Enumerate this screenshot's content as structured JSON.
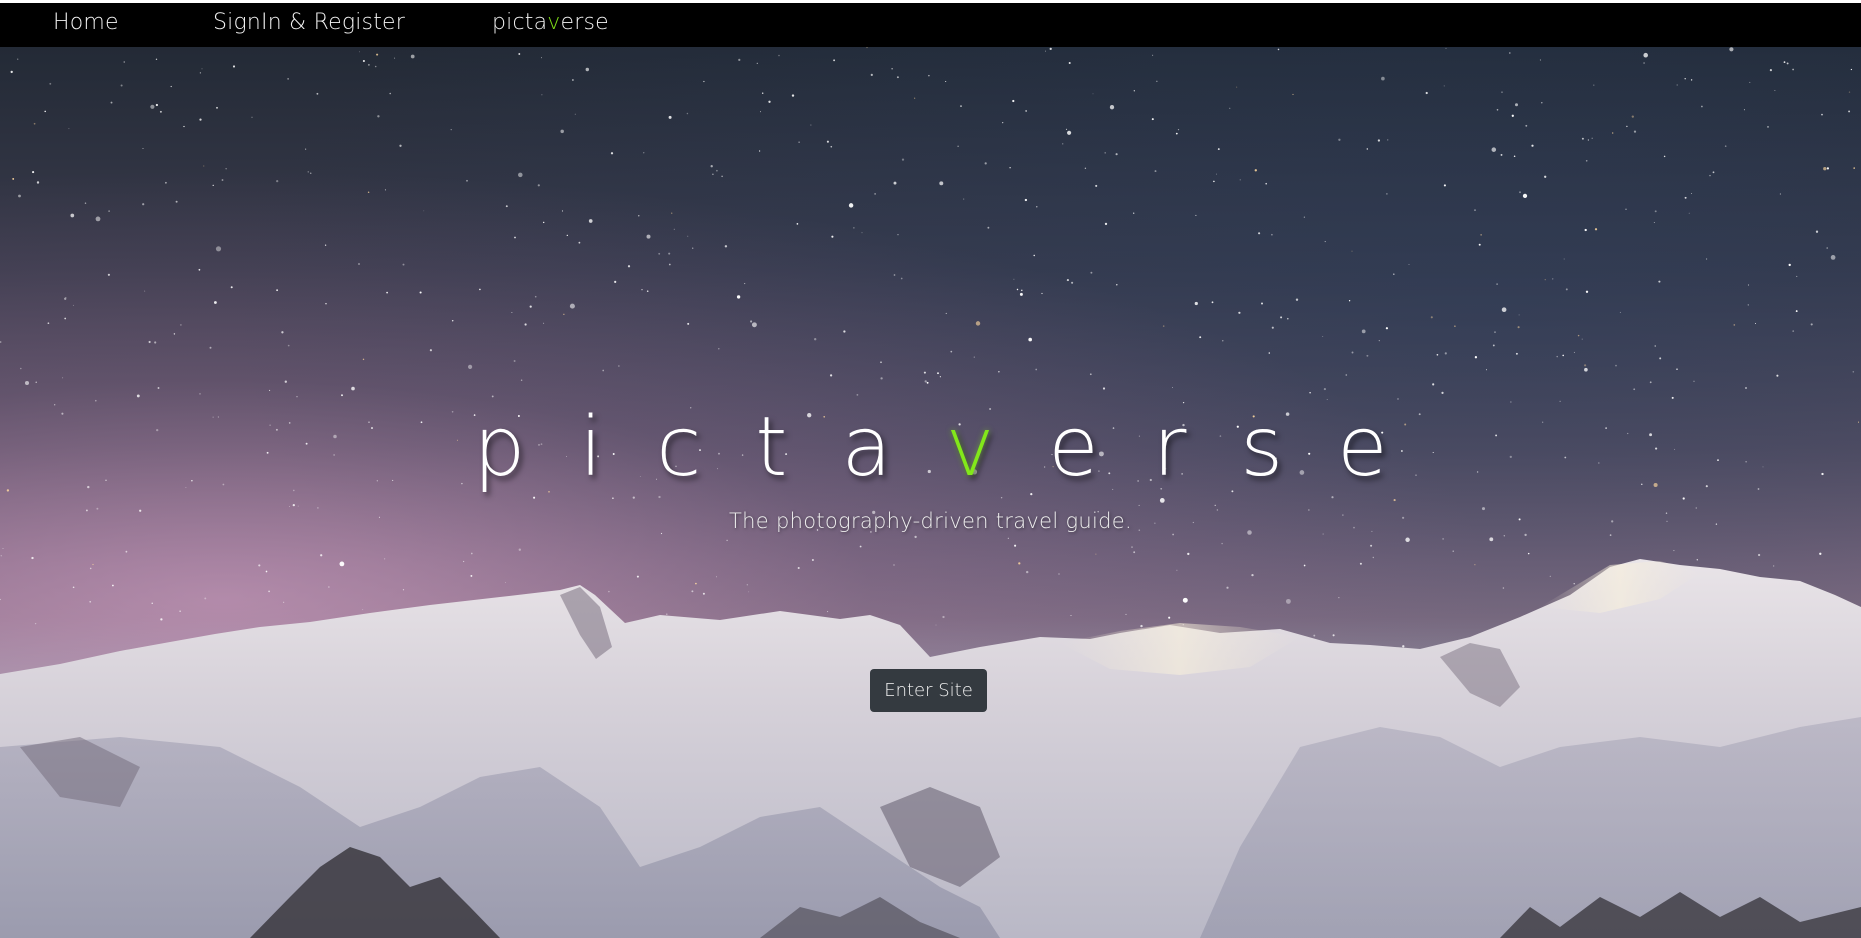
{
  "nav": {
    "home_label": "Home",
    "signin_label": "SignIn & Register",
    "brand_prefix": "picta",
    "brand_accent": "v",
    "brand_suffix": "erse"
  },
  "hero": {
    "title_prefix": "picta",
    "title_accent": "v",
    "title_suffix": "erse",
    "subtitle": "The photography-driven travel guide.",
    "enter_button_label": "Enter Site"
  },
  "colors": {
    "nav_background": "#000000",
    "accent": "#82e81a",
    "button_background": "#343a40",
    "text": "#ffffff"
  },
  "background_image": "night-sky-snowy-mountains"
}
